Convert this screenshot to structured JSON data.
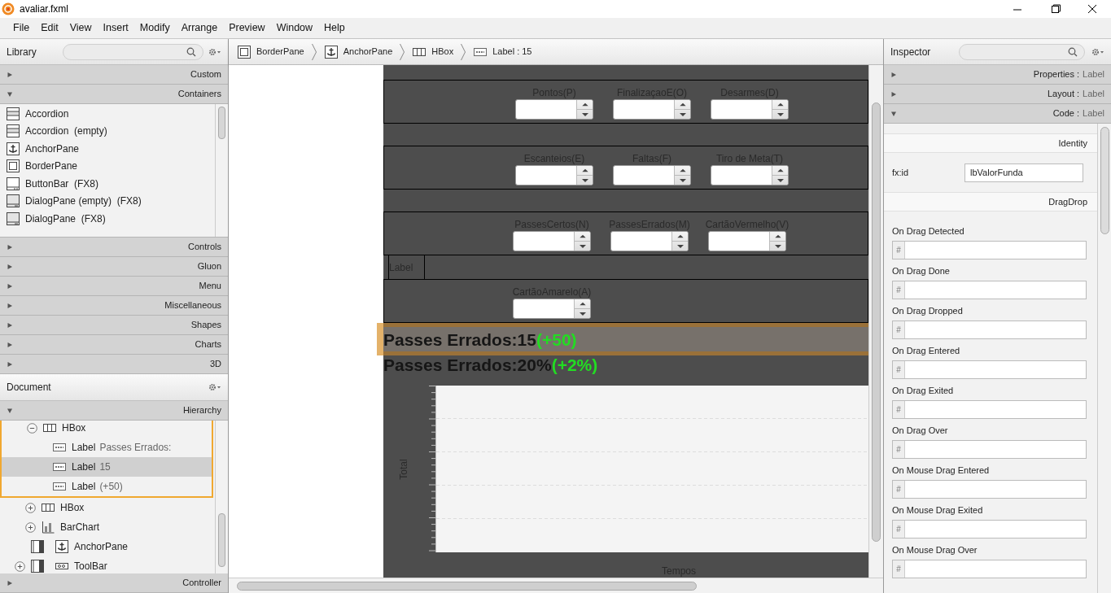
{
  "window": {
    "title": "avaliar.fxml"
  },
  "menu": [
    "File",
    "Edit",
    "View",
    "Insert",
    "Modify",
    "Arrange",
    "Preview",
    "Window",
    "Help"
  ],
  "library": {
    "title": "Library",
    "sections_before": [
      {
        "label": "Custom",
        "expanded": false
      },
      {
        "label": "Containers",
        "expanded": true
      }
    ],
    "items": [
      {
        "kind": "accordion",
        "label": "Accordion"
      },
      {
        "kind": "accordion",
        "label": "Accordion  (empty)"
      },
      {
        "kind": "anchor",
        "label": "AnchorPane"
      },
      {
        "kind": "border",
        "label": "BorderPane"
      },
      {
        "kind": "buttonbar",
        "label": "ButtonBar  (FX8)"
      },
      {
        "kind": "dialog",
        "label": "DialogPane (empty)  (FX8)"
      },
      {
        "kind": "dialog",
        "label": "DialogPane  (FX8)"
      }
    ],
    "sections_after": [
      {
        "label": "Controls",
        "expanded": false
      },
      {
        "label": "Gluon",
        "expanded": false
      },
      {
        "label": "Menu",
        "expanded": false
      },
      {
        "label": "Miscellaneous",
        "expanded": false
      },
      {
        "label": "Shapes",
        "expanded": false
      },
      {
        "label": "Charts",
        "expanded": false
      },
      {
        "label": "3D",
        "expanded": false
      }
    ]
  },
  "document": {
    "title": "Document",
    "hierarchy": {
      "label": "Hierarchy",
      "expanded": true
    },
    "nodes": [
      {
        "kind": "hbox",
        "name": "HBox",
        "expanded": true,
        "selected": false,
        "children": [
          {
            "kind": "label",
            "name": "Label",
            "detail": "Passes Errados:",
            "selected": false
          },
          {
            "kind": "label",
            "name": "Label",
            "detail": "15",
            "selected": true
          },
          {
            "kind": "label",
            "name": "Label",
            "detail": "(+50)",
            "selected": false
          }
        ]
      },
      {
        "kind": "hbox",
        "name": "HBox",
        "expanded": false,
        "selected": false
      },
      {
        "kind": "chart",
        "name": "BarChart",
        "expanded": false,
        "selected": false
      },
      {
        "kind": "anchor",
        "name": "AnchorPane",
        "slot": true,
        "selected": false
      },
      {
        "kind": "toolbar",
        "name": "ToolBar",
        "expanded": false,
        "slot": true,
        "selected": false
      }
    ],
    "controller": {
      "label": "Controller",
      "expanded": false
    }
  },
  "breadcrumbs": [
    {
      "kind": "border",
      "label": "BorderPane"
    },
    {
      "kind": "anchor",
      "label": "AnchorPane"
    },
    {
      "kind": "hbox",
      "label": "HBox"
    },
    {
      "kind": "label",
      "label": "Label : 15"
    }
  ],
  "design": {
    "rows": [
      {
        "kind": "spinners",
        "spinners": [
          {
            "label": "Pontos(P)"
          },
          {
            "label": "FinalizaçaoE(O)"
          },
          {
            "label": "Desarmes(D)"
          }
        ]
      },
      {
        "kind": "spinners",
        "spinners": [
          {
            "label": "Escanteios(E)"
          },
          {
            "label": "Faltas(F)"
          },
          {
            "label": "Tiro de Meta(T)"
          }
        ]
      },
      {
        "kind": "spinners",
        "spinners": [
          {
            "label": "PassesCertos(N)"
          },
          {
            "label": "PassesErrados(M)"
          },
          {
            "label": "CartãoVermelho(V)"
          }
        ]
      },
      {
        "kind": "label",
        "text": "Label"
      },
      {
        "kind": "spinners",
        "spinners": [
          {
            "label": "CartãoAmarelo(A)"
          }
        ]
      }
    ],
    "stats": [
      {
        "label": "Passes Errados:",
        "value": "15",
        "delta": "(+50)",
        "selected": true
      },
      {
        "label": "Passes Errados:",
        "value": "20%",
        "delta": "(+2%)",
        "selected": false
      }
    ],
    "chart": {
      "ylabel": "Total",
      "xlabel": "Tempos"
    }
  },
  "inspector": {
    "title": "Inspector",
    "sections": [
      {
        "label": "Properties :",
        "target": "Label",
        "expanded": false
      },
      {
        "label": "Layout :",
        "target": "Label",
        "expanded": false
      },
      {
        "label": "Code :",
        "target": "Label",
        "expanded": true
      }
    ],
    "identity": {
      "header": "Identity",
      "field_label": "fx:id",
      "value": "lbValorFunda"
    },
    "dragdrop": {
      "header": "DragDrop",
      "prefix": "#",
      "handlers": [
        "On Drag Detected",
        "On Drag Done",
        "On Drag Dropped",
        "On Drag Entered",
        "On Drag Exited",
        "On Drag Over",
        "On Mouse Drag Entered",
        "On Mouse Drag Exited",
        "On Mouse Drag Over"
      ]
    }
  }
}
